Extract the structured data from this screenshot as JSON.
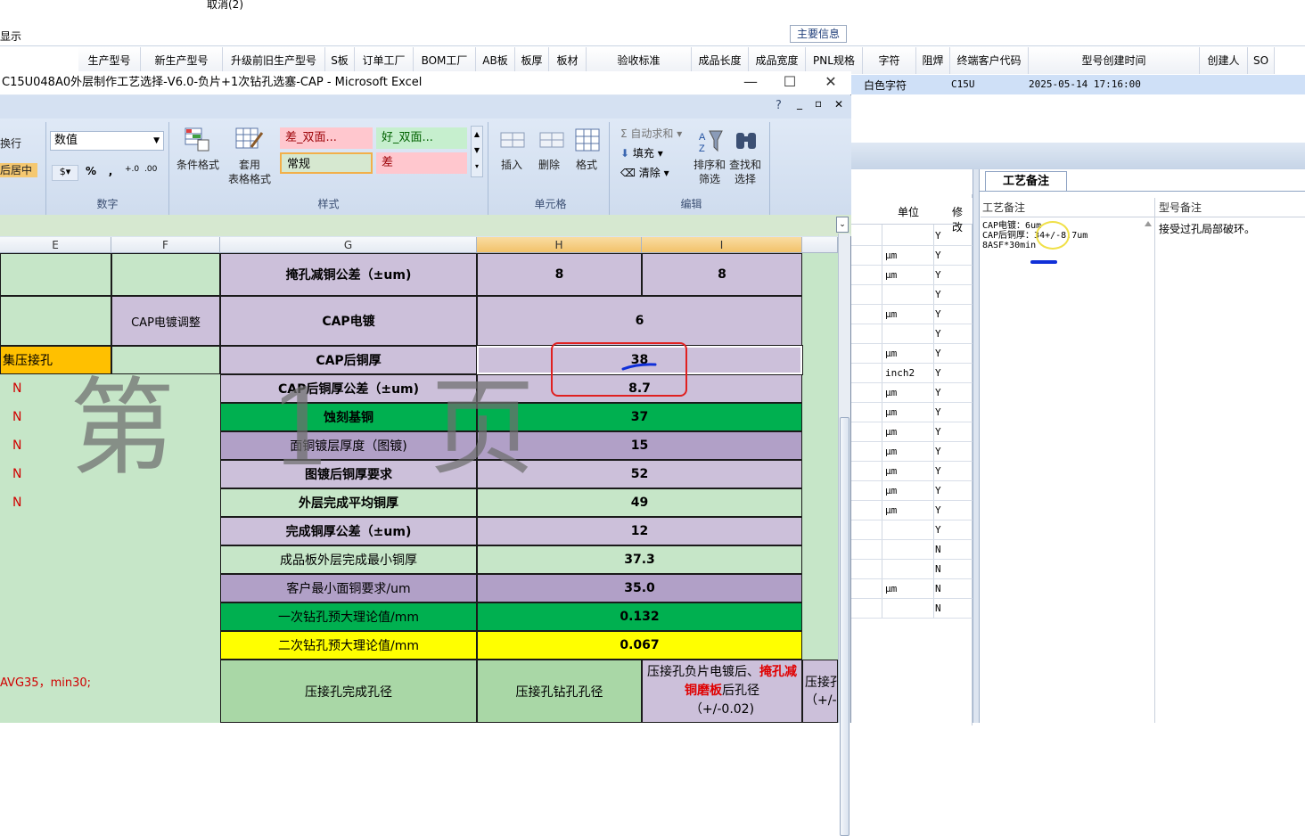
{
  "bg_app": {
    "cancel_text": "取消(2)",
    "left_text": "显示",
    "main_info_tab": "主要信息",
    "columns": [
      "生产型号",
      "新生产型号",
      "升级前旧生产型号",
      "S板",
      "订单工厂",
      "BOM工厂",
      "AB板",
      "板厚",
      "板材",
      "验收标准",
      "成品长度",
      "成品宽度",
      "PNL规格",
      "字符",
      "阻焊",
      "终端客户代码",
      "型号创建时间",
      "创建人",
      "SO"
    ],
    "row": {
      "char": "白色字符",
      "code": "C15U",
      "time": "2025-05-14 17:16:00"
    }
  },
  "excel": {
    "title": "C15U048A0外层制作工艺选择-V6.0-负片+1次钻孔选塞-CAP - Microsoft Excel",
    "ribbon": {
      "wrap_text": "换行",
      "merge_text": "后居中",
      "number_format": "数值",
      "percent": "%",
      "comma": ",",
      "group_number": "数字",
      "cond_format": "条件格式",
      "table_format": "套用\n表格格式",
      "style_bad_double": "差_双面...",
      "style_good_double": "好_双面...",
      "style_normal": "常规",
      "style_bad": "差",
      "group_style": "样式",
      "insert": "插入",
      "delete": "删除",
      "format": "格式",
      "group_cells": "单元格",
      "autosum": "自动求和",
      "fill": "填充",
      "clear": "清除",
      "sort_filter": "排序和\n筛选",
      "find_select": "查找和\n选择",
      "group_edit": "编辑"
    },
    "columns": [
      "E",
      "F",
      "G",
      "H",
      "I"
    ],
    "watermark": "第 1 页",
    "left_cells": {
      "cap_adjust": "CAP电镀调整",
      "press_hole": "集压接孔",
      "flags": [
        "N",
        "N",
        "N",
        "N",
        "N"
      ],
      "note": "AVG35，min30;"
    },
    "rows": [
      {
        "label": "掩孔减铜公差（±um)",
        "h": "8",
        "i": "8"
      },
      {
        "label": "CAP电镀",
        "value": "6"
      },
      {
        "label": "CAP后铜厚",
        "value": "38"
      },
      {
        "label": "CAP后铜厚公差（±um)",
        "value": "8.7"
      },
      {
        "label": "蚀刻基铜",
        "value": "37"
      },
      {
        "label": "面铜镀层厚度（图镀)",
        "value": "15"
      },
      {
        "label": "图镀后铜厚要求",
        "value": "52"
      },
      {
        "label": "外层完成平均铜厚",
        "value": "49"
      },
      {
        "label": "完成铜厚公差（±um)",
        "value": "12"
      },
      {
        "label": "成品板外层完成最小铜厚",
        "value": "37.3"
      },
      {
        "label": "客户最小面铜要求/um",
        "value": "35.0"
      },
      {
        "label": "一次钻孔预大理论值/mm",
        "value": "0.132"
      },
      {
        "label": "二次钻孔预大理论值/mm",
        "value": "0.067"
      }
    ],
    "bottom_row": {
      "g": "压接孔完成孔径",
      "h": "压接孔钻孔孔径",
      "i_pre": "压接孔负片电镀后、",
      "i_red": "掩孔减铜磨板",
      "i_post": "后孔径",
      "i_tol": "（+/-0.02)",
      "j": "压接孔",
      "j_tol": "（+/-"
    }
  },
  "right_panel": {
    "unit_header": "单位",
    "modify_header": "修改",
    "units": [
      "",
      "μm",
      "μm",
      "",
      "μm",
      "",
      "μm",
      "inch2",
      "μm",
      "μm",
      "μm",
      "μm",
      "μm",
      "μm",
      "μm",
      "",
      "",
      "",
      "μm",
      ""
    ],
    "yn": [
      "Y",
      "Y",
      "Y",
      "Y",
      "Y",
      "Y",
      "Y",
      "Y",
      "Y",
      "Y",
      "Y",
      "Y",
      "Y",
      "Y",
      "Y",
      "Y",
      "N",
      "N",
      "N",
      "N"
    ],
    "tab": "工艺备注",
    "craft_note_header": "工艺备注",
    "model_note_header": "型号备注",
    "craft_note_lines": [
      "CAP电镀：6um",
      "CAP后铜厚：34+/-8.7um",
      "8ASF*30min"
    ],
    "model_note": "接受过孔局部破环。"
  }
}
